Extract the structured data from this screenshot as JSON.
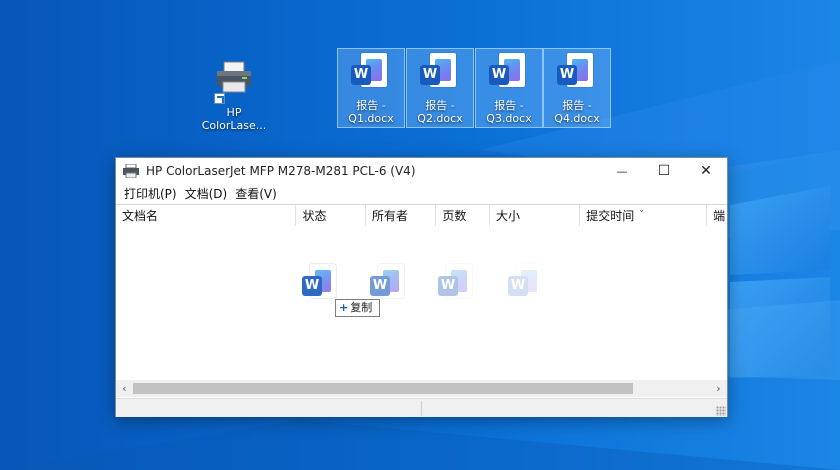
{
  "desktop": {
    "icons": [
      {
        "label": "HP\nColorLase...",
        "icon": "printer-icon"
      },
      {
        "label": "报告 -\nQ1.docx",
        "icon": "word-document-icon"
      },
      {
        "label": "报告 -\nQ2.docx",
        "icon": "word-document-icon"
      },
      {
        "label": "报告 -\nQ3.docx",
        "icon": "word-document-icon"
      },
      {
        "label": "报告 -\nQ4.docx",
        "icon": "word-document-icon"
      }
    ],
    "word_badge": "W"
  },
  "window": {
    "title": "HP ColorLaserJet MFP M278-M281 PCL-6 (V4)",
    "controls": {
      "minimize": "—",
      "maximize": "☐",
      "close": "✕"
    },
    "menu": [
      "打印机(P)",
      "文档(D)",
      "查看(V)"
    ],
    "columns": [
      "文档名",
      "状态",
      "所有者",
      "页数",
      "大小",
      "提交时间",
      "端"
    ],
    "sort_indicator": "⌄",
    "drag_badge": {
      "plus": "+",
      "text": "复制"
    },
    "scroll": {
      "left": "‹",
      "right": "›"
    }
  },
  "colors": {
    "accent": "#185abd",
    "desktop_blue": "#0a62c9"
  }
}
